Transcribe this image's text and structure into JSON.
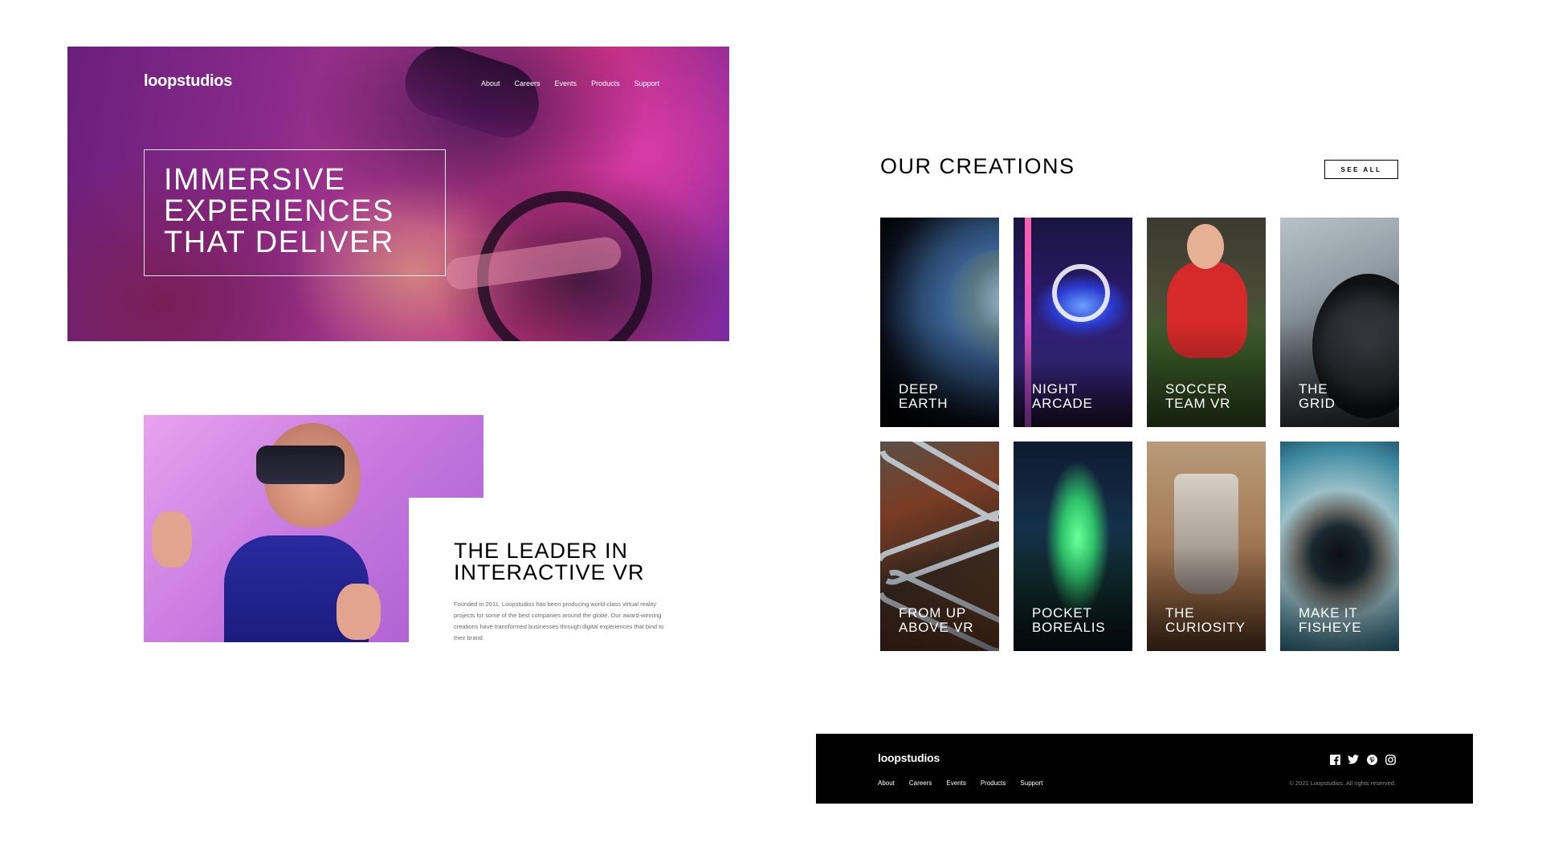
{
  "brand": {
    "logo": "loopstudios"
  },
  "nav": {
    "items": [
      {
        "label": "About"
      },
      {
        "label": "Careers"
      },
      {
        "label": "Events"
      },
      {
        "label": "Products"
      },
      {
        "label": "Support"
      }
    ]
  },
  "hero": {
    "lines": [
      "IMMERSIVE",
      "EXPERIENCES",
      "THAT DELIVER"
    ]
  },
  "leader": {
    "title_lines": [
      "THE LEADER IN",
      "INTERACTIVE VR"
    ],
    "text": "Founded in 2011, Loopstudios has been producing world-class virtual reality projects for some of the best companies around the globe. Our award-winning creations have transformed businesses through digital experiences that bind to their brand."
  },
  "creations": {
    "title": "OUR CREATIONS",
    "see_all": "SEE ALL",
    "items": [
      {
        "lines": [
          "DEEP",
          "EARTH"
        ]
      },
      {
        "lines": [
          "NIGHT",
          "ARCADE"
        ]
      },
      {
        "lines": [
          "SOCCER",
          "TEAM VR"
        ]
      },
      {
        "lines": [
          "THE",
          "GRID"
        ]
      },
      {
        "lines": [
          "FROM UP",
          "ABOVE VR"
        ]
      },
      {
        "lines": [
          "POCKET",
          "BOREALIS"
        ]
      },
      {
        "lines": [
          "THE",
          "CURIOSITY"
        ]
      },
      {
        "lines": [
          "MAKE IT",
          "FISHEYE"
        ]
      }
    ]
  },
  "footer": {
    "logo": "loopstudios",
    "nav": [
      "About",
      "Careers",
      "Events",
      "Products",
      "Support"
    ],
    "socials": [
      "facebook-icon",
      "twitter-icon",
      "pinterest-icon",
      "instagram-icon"
    ],
    "copyright": "© 2021 Loopstudios. All rights reserved."
  },
  "colors": {
    "footer_bg": "#000000",
    "text_muted": "#6b6b6b",
    "white": "#ffffff"
  }
}
